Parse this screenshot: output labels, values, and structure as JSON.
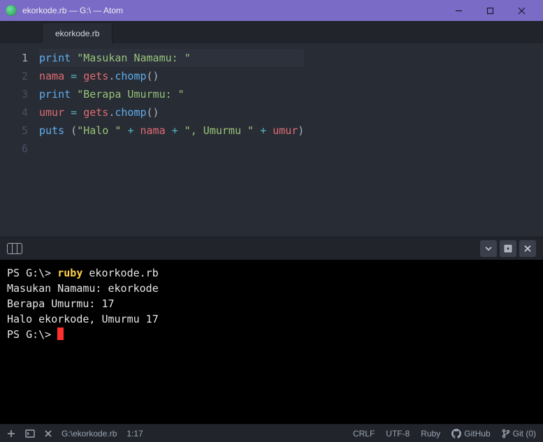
{
  "window": {
    "title": "ekorkode.rb — G:\\ — Atom"
  },
  "tabs": {
    "active": "ekorkode.rb"
  },
  "editor": {
    "lines": [
      {
        "n": 1,
        "tokens": [
          {
            "t": "print",
            "c": "func"
          },
          {
            "t": " ",
            "c": "default"
          },
          {
            "t": "\"Masukan Namamu: \"",
            "c": "str"
          }
        ]
      },
      {
        "n": 2,
        "tokens": [
          {
            "t": "nama",
            "c": "ident"
          },
          {
            "t": " ",
            "c": "default"
          },
          {
            "t": "=",
            "c": "op"
          },
          {
            "t": " ",
            "c": "default"
          },
          {
            "t": "gets",
            "c": "ident"
          },
          {
            "t": ".",
            "c": "punc"
          },
          {
            "t": "chomp",
            "c": "func"
          },
          {
            "t": "()",
            "c": "punc"
          }
        ]
      },
      {
        "n": 3,
        "tokens": [
          {
            "t": "print",
            "c": "func"
          },
          {
            "t": " ",
            "c": "default"
          },
          {
            "t": "\"Berapa Umurmu: \"",
            "c": "str"
          }
        ]
      },
      {
        "n": 4,
        "tokens": [
          {
            "t": "umur",
            "c": "ident"
          },
          {
            "t": " ",
            "c": "default"
          },
          {
            "t": "=",
            "c": "op"
          },
          {
            "t": " ",
            "c": "default"
          },
          {
            "t": "gets",
            "c": "ident"
          },
          {
            "t": ".",
            "c": "punc"
          },
          {
            "t": "chomp",
            "c": "func"
          },
          {
            "t": "()",
            "c": "punc"
          }
        ]
      },
      {
        "n": 5,
        "tokens": [
          {
            "t": "puts",
            "c": "func"
          },
          {
            "t": " ",
            "c": "default"
          },
          {
            "t": "(",
            "c": "punc"
          },
          {
            "t": "\"Halo \"",
            "c": "str"
          },
          {
            "t": " ",
            "c": "default"
          },
          {
            "t": "+",
            "c": "op"
          },
          {
            "t": " ",
            "c": "default"
          },
          {
            "t": "nama",
            "c": "ident"
          },
          {
            "t": " ",
            "c": "default"
          },
          {
            "t": "+",
            "c": "op"
          },
          {
            "t": " ",
            "c": "default"
          },
          {
            "t": "\", Umurmu \"",
            "c": "str"
          },
          {
            "t": " ",
            "c": "default"
          },
          {
            "t": "+",
            "c": "op"
          },
          {
            "t": " ",
            "c": "default"
          },
          {
            "t": "umur",
            "c": "ident"
          },
          {
            "t": ")",
            "c": "punc"
          }
        ]
      },
      {
        "n": 6,
        "tokens": []
      }
    ],
    "current_line": 1
  },
  "terminal": {
    "lines": [
      [
        {
          "t": "PS G:\\> ",
          "c": "ps-prompt"
        },
        {
          "t": "ruby ",
          "c": "ps-cmd"
        },
        {
          "t": "ekorkode.rb",
          "c": "ps-prompt"
        }
      ],
      [
        {
          "t": "Masukan Namamu: ekorkode",
          "c": "ps-prompt"
        }
      ],
      [
        {
          "t": "Berapa Umurmu: 17",
          "c": "ps-prompt"
        }
      ],
      [
        {
          "t": "Halo ekorkode, Umurmu 17",
          "c": "ps-prompt"
        }
      ],
      [
        {
          "t": "PS G:\\> ",
          "c": "ps-prompt"
        },
        {
          "cursor": true
        }
      ]
    ]
  },
  "status": {
    "path": "G:\\ekorkode.rb",
    "cursor": "1:17",
    "crlf": "CRLF",
    "encoding": "UTF-8",
    "lang": "Ruby",
    "github": "GitHub",
    "git": "Git (0)"
  }
}
